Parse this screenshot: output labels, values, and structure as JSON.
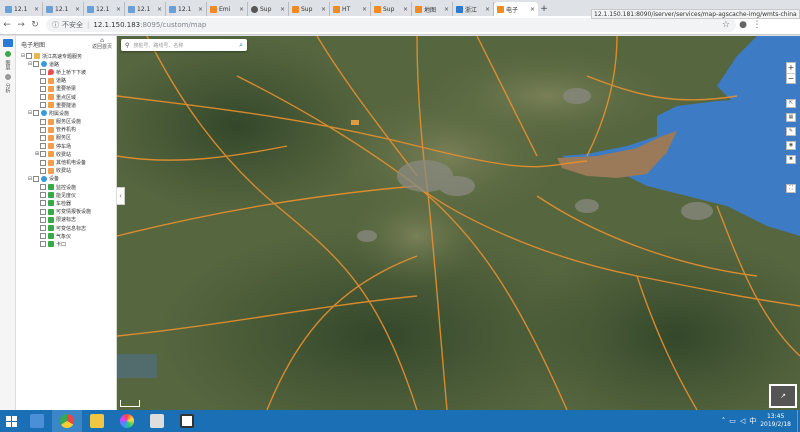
{
  "browser": {
    "tabs": [
      {
        "label": "12.1",
        "icon": "cloud"
      },
      {
        "label": "12.1",
        "icon": "cloud"
      },
      {
        "label": "12.1",
        "icon": "cloud"
      },
      {
        "label": "12.1",
        "icon": "cloud"
      },
      {
        "label": "12.1",
        "icon": "cloud"
      },
      {
        "label": "Emi",
        "icon": "ip"
      },
      {
        "label": "Sup",
        "icon": "sup"
      },
      {
        "label": "Sup",
        "icon": "ip"
      },
      {
        "label": "HT",
        "icon": "ip"
      },
      {
        "label": "Sup",
        "icon": "ip"
      },
      {
        "label": "地图",
        "icon": "ip"
      },
      {
        "label": "浙江",
        "icon": "blue"
      },
      {
        "label": "电子",
        "icon": "ip",
        "active": true
      }
    ],
    "tab_close": "×",
    "new_tab": "+",
    "hover_url": "12.1.150.181:8090/iserver/services/map-agscache-img/wmts-china",
    "address": {
      "security_label": "不安全",
      "separator": "|",
      "host": "12.1.150.183",
      "path": ":8095/custom/map"
    },
    "nav": {
      "back": "←",
      "forward": "→",
      "reload": "↻",
      "star": "☆",
      "menu": "⋮",
      "account": "●"
    }
  },
  "left_nav": {
    "items": [
      "图层",
      "分析"
    ]
  },
  "panel": {
    "title": "电子地图",
    "home_label": "返回首页",
    "tree": [
      {
        "level": 0,
        "toggle": "⊟",
        "icon": "folder",
        "label": "浙江高速专题服务"
      },
      {
        "level": 1,
        "toggle": "⊟",
        "icon": "globe",
        "label": "道路"
      },
      {
        "level": 2,
        "toggle": "",
        "icon": "pin",
        "label": "桥上桥下下坡"
      },
      {
        "level": 2,
        "toggle": "",
        "icon": "orange",
        "label": "道路"
      },
      {
        "level": 2,
        "toggle": "",
        "icon": "orange",
        "label": "重要桥梁"
      },
      {
        "level": 2,
        "toggle": "",
        "icon": "orange",
        "label": "重点区域"
      },
      {
        "level": 2,
        "toggle": "",
        "icon": "orange",
        "label": "重要隧道"
      },
      {
        "level": 1,
        "toggle": "⊟",
        "icon": "globe",
        "label": "附属设施"
      },
      {
        "level": 2,
        "toggle": "",
        "icon": "orange",
        "label": "服务区设施"
      },
      {
        "level": 2,
        "toggle": "",
        "icon": "orange",
        "label": "管养机构"
      },
      {
        "level": 2,
        "toggle": "",
        "icon": "orange",
        "label": "服务区"
      },
      {
        "level": 2,
        "toggle": "",
        "icon": "orange",
        "label": "停车场"
      },
      {
        "level": 2,
        "toggle": "⊞",
        "icon": "orange",
        "label": "收费站"
      },
      {
        "level": 2,
        "toggle": "",
        "icon": "orange",
        "label": "其他机电设备"
      },
      {
        "level": 2,
        "toggle": "",
        "icon": "orange",
        "label": "收费站"
      },
      {
        "level": 1,
        "toggle": "⊟",
        "icon": "globe",
        "label": "设备"
      },
      {
        "level": 2,
        "toggle": "",
        "icon": "green",
        "label": "监控设施"
      },
      {
        "level": 2,
        "toggle": "",
        "icon": "green",
        "label": "能见度仪"
      },
      {
        "level": 2,
        "toggle": "",
        "icon": "green",
        "label": "车检器"
      },
      {
        "level": 2,
        "toggle": "",
        "icon": "green",
        "label": "可变情报板设施"
      },
      {
        "level": 2,
        "toggle": "",
        "icon": "green",
        "label": "限速标志"
      },
      {
        "level": 2,
        "toggle": "",
        "icon": "green",
        "label": "可变信息标志"
      },
      {
        "level": 2,
        "toggle": "",
        "icon": "green",
        "label": "气象仪"
      },
      {
        "level": 2,
        "toggle": "",
        "icon": "green",
        "label": "卡口"
      }
    ]
  },
  "map": {
    "search_placeholder": "搜桩号、路线号、名称",
    "zoom_in": "+",
    "zoom_out": "−",
    "collapse": "‹",
    "colors": {
      "land": "#5d6b45",
      "sea": "#3d7cc4",
      "bay": "#9a7a58",
      "road": "#e8902e",
      "urban": "#8a8a80"
    }
  },
  "taskbar": {
    "time": "13:45",
    "date": "2019/2/18",
    "apps": [
      "store",
      "chrome",
      "files",
      "color",
      "java",
      "app"
    ]
  }
}
